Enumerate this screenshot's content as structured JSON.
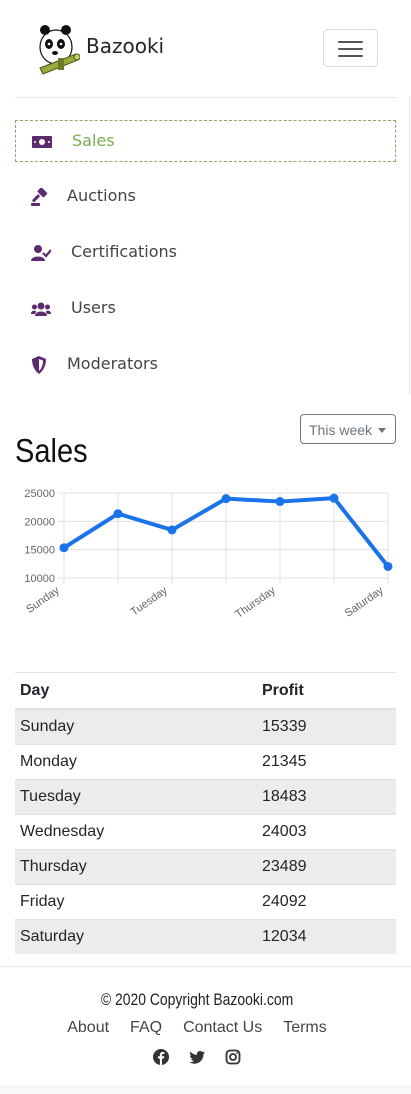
{
  "brand": {
    "name": "Bazooki",
    "logo_icon": "panda-bazooka-icon"
  },
  "nav": {
    "items": [
      {
        "label": "Sales",
        "icon": "money-bill-icon",
        "active": true
      },
      {
        "label": "Auctions",
        "icon": "gavel-icon",
        "active": false
      },
      {
        "label": "Certifications",
        "icon": "user-check-icon",
        "active": false
      },
      {
        "label": "Users",
        "icon": "users-icon",
        "active": false
      },
      {
        "label": "Moderators",
        "icon": "shield-icon",
        "active": false
      }
    ]
  },
  "colors": {
    "accent": "#7cab52",
    "icon": "#5b2b6e",
    "line": "#1a73e8"
  },
  "main": {
    "title": "Sales",
    "range_button": "This week"
  },
  "chart_data": {
    "type": "line",
    "categories": [
      "Sunday",
      "Monday",
      "Tuesday",
      "Wednesday",
      "Thursday",
      "Friday",
      "Saturday"
    ],
    "tick_labels": [
      "Sunday",
      "Tuesday",
      "Thursday",
      "Saturday"
    ],
    "values": [
      15339,
      21345,
      18483,
      24003,
      23489,
      24092,
      12034
    ],
    "yticks": [
      10000,
      15000,
      20000,
      25000
    ],
    "ylim": [
      10000,
      25000
    ],
    "grid": true,
    "legend": "none"
  },
  "table": {
    "headers": [
      "Day",
      "Profit"
    ],
    "rows": [
      [
        "Sunday",
        "15339"
      ],
      [
        "Monday",
        "21345"
      ],
      [
        "Tuesday",
        "18483"
      ],
      [
        "Wednesday",
        "24003"
      ],
      [
        "Thursday",
        "23489"
      ],
      [
        "Friday",
        "24092"
      ],
      [
        "Saturday",
        "12034"
      ]
    ]
  },
  "footer": {
    "copyright": "© 2020 Copyright Bazooki.com",
    "links": [
      "About",
      "FAQ",
      "Contact Us",
      "Terms"
    ],
    "social": [
      "facebook-icon",
      "twitter-icon",
      "instagram-icon"
    ]
  }
}
